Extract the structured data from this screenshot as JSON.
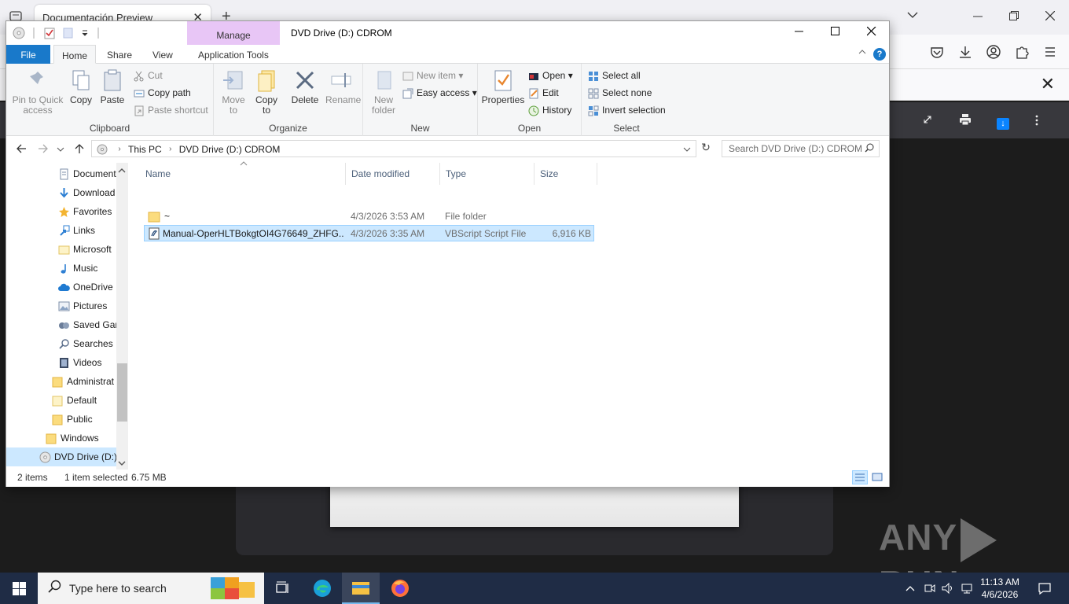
{
  "browser": {
    "tab_title": "Documentación Preview",
    "tab_close": "✕",
    "new_tab": "+",
    "find_close": "✕"
  },
  "watermark": {
    "left": "ANY",
    "right": "RUN"
  },
  "explorer": {
    "title": "DVD Drive (D:) CDROM",
    "contextual_tab": "Manage",
    "tabs": [
      "File",
      "Home",
      "Share",
      "View",
      "Application Tools"
    ],
    "ribbon": {
      "clipboard": {
        "label": "Clipboard",
        "pin": "Pin to Quick access",
        "copy": "Copy",
        "paste": "Paste",
        "cut": "Cut",
        "copy_path": "Copy path",
        "paste_shortcut": "Paste shortcut"
      },
      "organize": {
        "label": "Organize",
        "move_to": "Move to",
        "copy_to": "Copy to",
        "delete": "Delete",
        "rename": "Rename"
      },
      "new": {
        "label": "New",
        "new_folder": "New folder",
        "new_item": "New item",
        "easy_access": "Easy access"
      },
      "open": {
        "label": "Open",
        "properties": "Properties",
        "open": "Open",
        "edit": "Edit",
        "history": "History"
      },
      "select": {
        "label": "Select",
        "select_all": "Select all",
        "select_none": "Select none",
        "invert_selection": "Invert selection"
      }
    },
    "address": {
      "crumbs": [
        "This PC",
        "DVD Drive (D:) CDROM"
      ],
      "search_placeholder": "Search DVD Drive (D:) CDROM"
    },
    "nav_items": [
      "Document",
      "Download",
      "Favorites",
      "Links",
      "Microsoft",
      "Music",
      "OneDrive",
      "Pictures",
      "Saved Gan",
      "Searches",
      "Videos",
      "Administrat",
      "Default",
      "Public",
      "Windows",
      "DVD Drive (D:)"
    ],
    "columns": [
      "Name",
      "Date modified",
      "Type",
      "Size"
    ],
    "files": [
      {
        "name": "~",
        "date": "4/3/2026 3:53 AM",
        "type": "File folder",
        "size": ""
      },
      {
        "name": "Manual-OperHLTBokgtOI4G76649_ZHFG...",
        "date": "4/3/2026 3:35 AM",
        "type": "VBScript Script File",
        "size": "6,916 KB"
      }
    ],
    "status": {
      "items": "2 items",
      "selected": "1 item selected",
      "size": "6.75 MB"
    }
  },
  "taskbar": {
    "search_placeholder": "Type here to search",
    "time": "11:13 AM",
    "date": "4/6/2026"
  },
  "colors": {
    "accent": "#1979ca",
    "selection": "#cce8ff",
    "contextual": "#e8c6f6",
    "taskbar": "#1f2c45"
  }
}
